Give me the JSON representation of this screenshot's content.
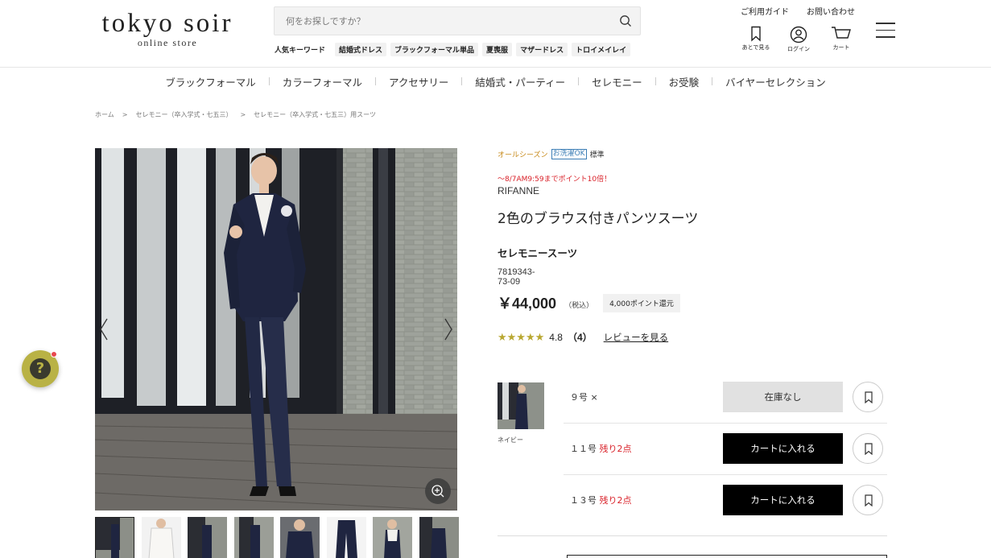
{
  "header": {
    "logo_main": "tokyo soir",
    "logo_sub": "online store",
    "search_placeholder": "何をお探しですか？",
    "keywords_title": "人気キーワード",
    "keywords": [
      "結婚式ドレス",
      "ブラックフォーマル単品",
      "夏喪服",
      "マザードレス",
      "トロイメイレイ"
    ],
    "util_links": [
      "ご利用ガイド",
      "お問い合わせ"
    ],
    "util_icons": [
      {
        "icon": "bookmark-icon",
        "label": "あとで見る"
      },
      {
        "icon": "user-icon",
        "label": "ログイン"
      },
      {
        "icon": "cart-icon",
        "label": "カート"
      }
    ]
  },
  "nav": [
    "ブラックフォーマル",
    "カラーフォーマル",
    "アクセサリー",
    "結婚式・パーティー",
    "セレモニー",
    "お受験",
    "バイヤーセレクション"
  ],
  "breadcrumb": [
    "ホーム",
    "セレモニー（卒入学式・七五三）",
    "セレモニー（卒入学式・七五三）用スーツ"
  ],
  "breadcrumb_sep": ">",
  "product": {
    "tags": {
      "season": "オールシーズン",
      "wash": "お洗濯OK",
      "standard": "標準"
    },
    "promo": "〜8/7AM9:59までポイント10倍！",
    "brand": "RIFANNE",
    "title": "2色のブラウス付きパンツスーツ",
    "category": "セレモニースーツ",
    "code": "7819343-73-09",
    "price": "￥44,000",
    "tax": "（税込）",
    "points": "4,000ポイント還元",
    "stars": "★★★★★",
    "rating": "4.8",
    "rating_count": "（4）",
    "review_link": "レビューを見る"
  },
  "variant": {
    "color": "ネイビー",
    "sizes": [
      {
        "size": "９号",
        "status": "×",
        "low": "",
        "button": "在庫なし",
        "available": false
      },
      {
        "size": "１１号",
        "status": "",
        "low": "残り2点",
        "button": "カートに入れる",
        "available": true
      },
      {
        "size": "１３号",
        "status": "",
        "low": "残り2点",
        "button": "カートに入れる",
        "available": true
      }
    ]
  },
  "help_icon": "?",
  "colors": {
    "accent": "#b9b245",
    "promo_red": "#d9222a",
    "wash_blue": "#3b7db5",
    "season_orange": "#c78a1a"
  }
}
